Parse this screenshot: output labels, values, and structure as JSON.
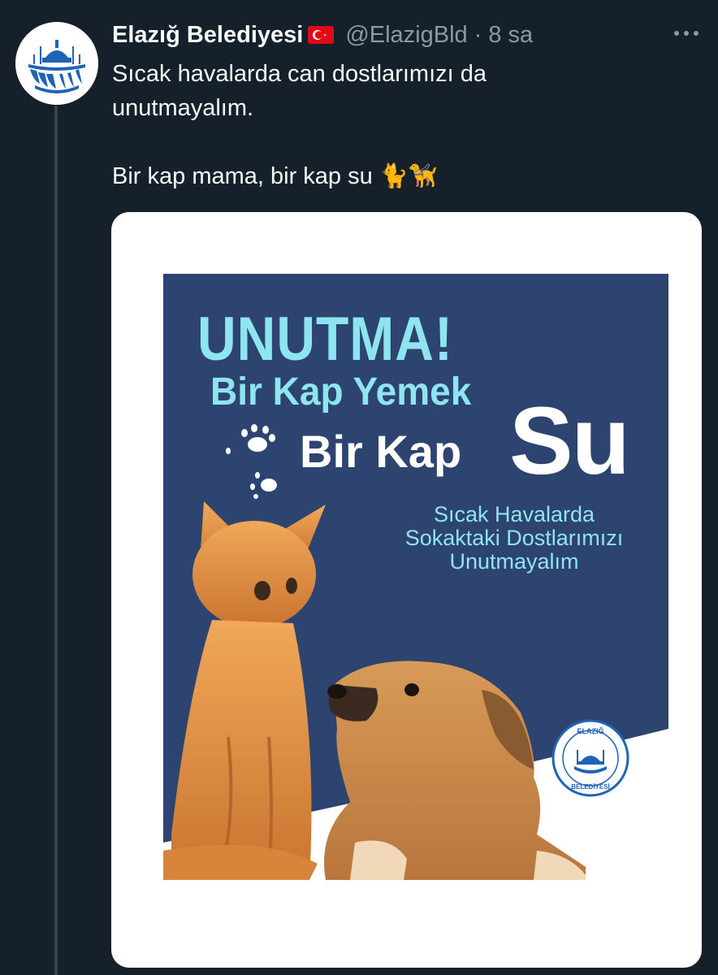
{
  "tweet": {
    "display_name": "Elazığ Belediyesi",
    "handle": "@ElazigBld",
    "separator": "·",
    "time": "8 sa",
    "text_line1": "Sıcak havalarda can dostlarımızı da",
    "text_line2": "unutmayalım.",
    "text_line3": "Bir kap mama, bir kap su 🐈🦮",
    "icons": {
      "avatar": "municipality-logo",
      "flag": "turkey-flag-icon",
      "more": "more-dots-icon"
    }
  },
  "poster": {
    "headline": "UNUTMA!",
    "line_yemek": "Bir Kap Yemek",
    "line_kap": "Bir Kap",
    "line_su": "Su",
    "sub_line1": "Sıcak Havalarda",
    "sub_line2": "Sokaktaki Dostlarımızı",
    "sub_line3": "Unutmayalım",
    "seal_text": "ELAZIĞ BELEDİYESİ",
    "colors": {
      "background": "#2d4470",
      "accent": "#8ee4ef",
      "text": "#ffffff"
    }
  }
}
